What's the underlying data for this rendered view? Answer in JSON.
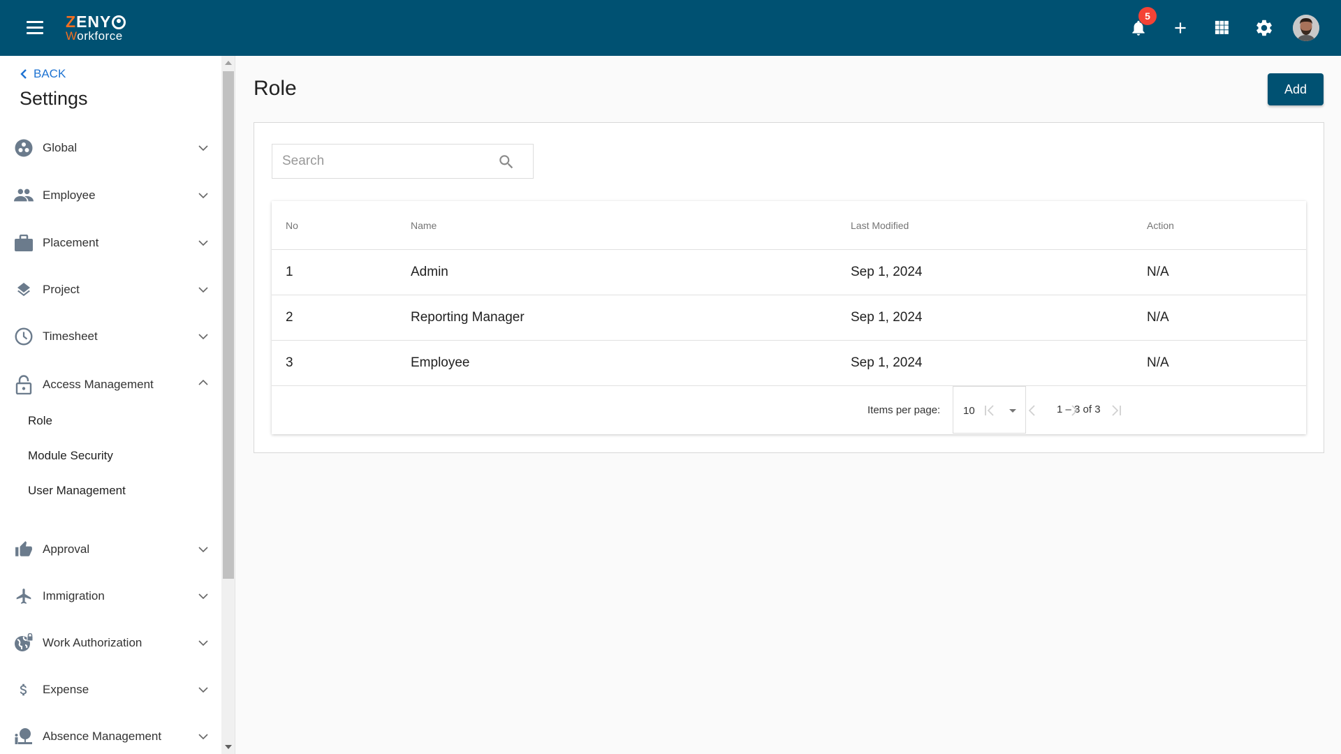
{
  "app": {
    "logo_line1": "ZENY",
    "logo_line2": "Workforce",
    "notifications_count": "5",
    "brand_color": "#005172",
    "accent_color": "#f36f21"
  },
  "topbar": {
    "icons": [
      "menu-icon",
      "bell-icon",
      "plus-icon",
      "apps-grid-icon",
      "gear-icon",
      "user-avatar"
    ]
  },
  "sidebar": {
    "back_label": "BACK",
    "title": "Settings",
    "items": [
      {
        "label": "Global",
        "icon": "global-icon",
        "expanded": false
      },
      {
        "label": "Employee",
        "icon": "people-icon",
        "expanded": false
      },
      {
        "label": "Placement",
        "icon": "briefcase-icon",
        "expanded": false
      },
      {
        "label": "Project",
        "icon": "layers-icon",
        "expanded": false
      },
      {
        "label": "Timesheet",
        "icon": "clock-icon",
        "expanded": false
      },
      {
        "label": "Access Management",
        "icon": "lock-icon",
        "expanded": true,
        "children": [
          "Role",
          "Module Security",
          "User Management"
        ]
      },
      {
        "label": "Approval",
        "icon": "thumbs-up-icon",
        "expanded": false
      },
      {
        "label": "Immigration",
        "icon": "airplane-icon",
        "expanded": false
      },
      {
        "label": "Work Authorization",
        "icon": "globe-lock-icon",
        "expanded": false
      },
      {
        "label": "Expense",
        "icon": "dollar-icon",
        "expanded": false
      },
      {
        "label": "Absence Management",
        "icon": "absence-icon",
        "expanded": false
      }
    ]
  },
  "main": {
    "title": "Role",
    "add_label": "Add",
    "search_placeholder": "Search",
    "search_value": "",
    "table": {
      "columns": [
        "No",
        "Name",
        "Last Modified",
        "Action"
      ],
      "rows": [
        {
          "no": "1",
          "name": "Admin",
          "last_modified": "Sep 1, 2024",
          "action": "N/A"
        },
        {
          "no": "2",
          "name": "Reporting Manager",
          "last_modified": "Sep 1, 2024",
          "action": "N/A"
        },
        {
          "no": "3",
          "name": "Employee",
          "last_modified": "Sep 1, 2024",
          "action": "N/A"
        }
      ]
    },
    "paginator": {
      "items_per_page_label": "Items per page:",
      "items_per_page": "10",
      "range": "1 – 3 of 3"
    }
  }
}
